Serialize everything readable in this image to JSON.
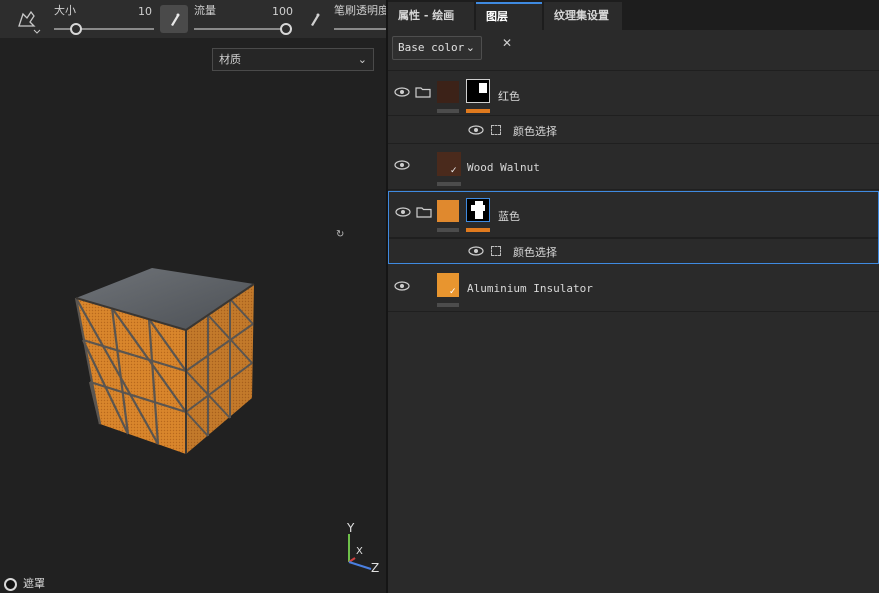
{
  "toolbar": {
    "size_label": "大小",
    "size_value": "10",
    "size_fraction": 0.22,
    "flow_label": "流量",
    "flow_value": "100",
    "flow_fraction": 1.0,
    "opacity_label": "笔刷透明度"
  },
  "viewport": {
    "material_select": "材质",
    "mask_label": "遮罩",
    "axis_y": "Y",
    "axis_x": "X",
    "axis_z": "Z"
  },
  "tabs": {
    "properties": "属性 - 绘画",
    "layers": "图层",
    "texture_set": "纹理集设置",
    "close_glyph": "✕"
  },
  "channel_select": "Base color",
  "layers": {
    "red_group": {
      "name": "红色",
      "effect": "颜色选择"
    },
    "wood": {
      "name": "Wood Walnut"
    },
    "blue_group": {
      "name": "蓝色",
      "effect": "颜色选择"
    },
    "aluminium": {
      "name": "Aluminium Insulator"
    }
  },
  "colors": {
    "accent": "#3f8ae0",
    "mask_bar": "#e07a1e",
    "wood": "#4a2a1c",
    "orange": "#e0892e"
  }
}
